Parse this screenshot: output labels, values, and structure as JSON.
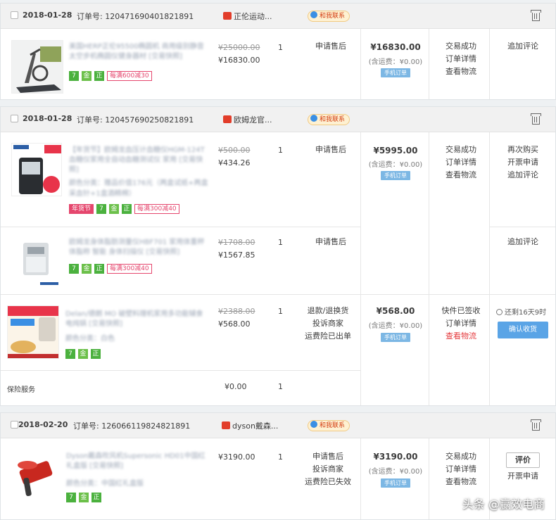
{
  "orders": [
    {
      "date": "2018-01-28",
      "order_no_label": "订单号:",
      "order_no": "120471690401821891",
      "shop_name": "正伦运动...",
      "contact_label": "和我联系",
      "items": [
        {
          "title": "美国HERP正伦95500椭圆机 商用级别静音太空步机椭圆仪健身器材 [交易快照]",
          "promo_tag": "每满600减30",
          "price_orig": "¥25000.00",
          "price_now": "¥16830.00",
          "qty": "1",
          "service": [
            "申请售后"
          ]
        }
      ],
      "total": "¥16830.00",
      "shipping": "(含运费：¥0.00)",
      "phone_order": "手机订单",
      "status": [
        "交易成功",
        "订单详情",
        "查看物流"
      ],
      "ops": [
        "追加评论"
      ]
    },
    {
      "date": "2018-01-28",
      "order_no_label": "订单号:",
      "order_no": "120457690250821891",
      "shop_name": "欧姆龙官...",
      "contact_label": "和我联系",
      "items": [
        {
          "title": "【年货节】欧姆龙血压计血糖仪HGM-124T 血糖仪家用全自动血糖测试仪 家用 [交易快照]",
          "prop": "颜色分类：赠品价值176元（两盒试纸+两盒采血针+1盒酒精棉）",
          "nian_tag": "年货节",
          "promo_tag": "每满300减40",
          "price_orig": "¥500.00",
          "price_now": "¥434.26",
          "qty": "1",
          "service": [
            "申请售后"
          ],
          "ops": [
            "再次购买",
            "开票申请",
            "追加评论"
          ]
        },
        {
          "title": "欧姆龙身体脂肪测量仪HBF701 家用体重秤 体脂称 智能 身体扫描仪 [交易快照]",
          "promo_tag": "每满300减40",
          "price_orig": "¥1708.00",
          "price_now": "¥1567.85",
          "qty": "1",
          "service": [
            "申请售后"
          ],
          "ops": [
            "追加评论"
          ]
        }
      ],
      "total": "¥5995.00",
      "shipping": "(含运费：¥0.00)",
      "phone_order": "手机订单",
      "status": [
        "交易成功",
        "订单详情",
        "查看物流"
      ]
    },
    {
      "items": [
        {
          "title": "Delan/德朗 MO 破壁料理机家用多功能辅食 电炖锅 [交易快照]",
          "prop": "颜色分类：白色",
          "price_orig": "¥2388.00",
          "price_now": "¥568.00",
          "qty": "1",
          "service": [
            "退款/退换货",
            "投诉商家",
            "运费险已出单"
          ]
        }
      ],
      "insurance_label": "保险服务",
      "insurance_price": "¥0.00",
      "insurance_qty": "1",
      "total": "¥568.00",
      "shipping": "(含运费：¥0.00)",
      "phone_order": "手机订单",
      "status": [
        "快件已签收",
        "订单详情",
        "查看物流"
      ],
      "countdown": "还剩16天9时",
      "confirm": "确认收货"
    },
    {
      "date": "2018-02-20",
      "order_no_label": "订单号:",
      "order_no": "126066119824821891",
      "shop_name": "dyson戴森...",
      "contact_label": "和我联系",
      "items": [
        {
          "title": "Dyson戴森吹风机Supersonic HD01中国红礼盒版 [交易快照]",
          "prop": "颜色分类：中国红礼盒版",
          "price_now": "¥3190.00",
          "qty": "1",
          "service": [
            "申请售后",
            "投诉商家",
            "运费险已失效"
          ]
        }
      ],
      "total": "¥3190.00",
      "shipping": "(含运费：¥0.00)",
      "phone_order": "手机订单",
      "status": [
        "交易成功",
        "订单详情",
        "查看物流"
      ],
      "review": "评价",
      "ops": [
        "开票申请"
      ]
    }
  ],
  "tags": {
    "seven": "7",
    "gold": "金",
    "zheng": "正"
  },
  "watermark": "头条 @赢效电商",
  "colors": {
    "accent": "#5aa4e6",
    "promo": "#e5466d",
    "alert": "#e4393c"
  }
}
